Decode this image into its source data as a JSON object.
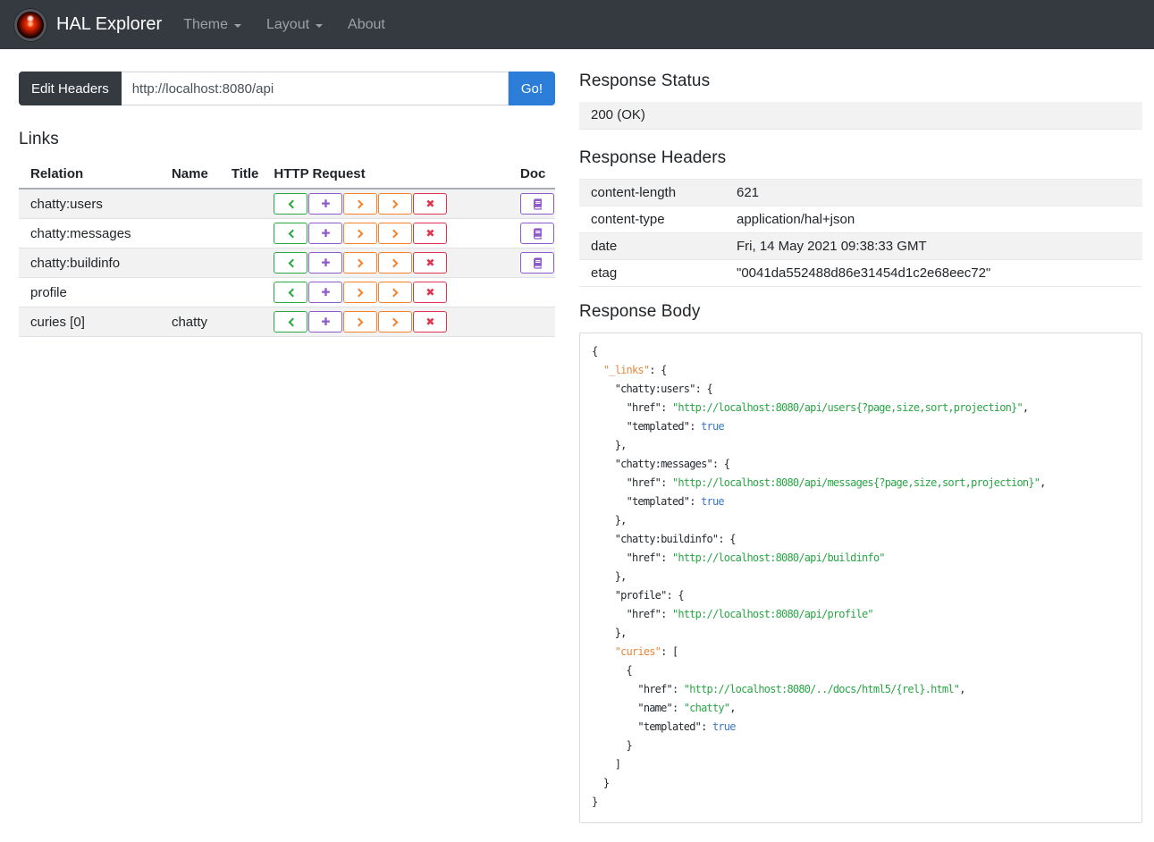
{
  "navbar": {
    "brand": "HAL Explorer",
    "logo": "hal-9000-eye-icon",
    "items": [
      {
        "label": "Theme",
        "has_dropdown": true
      },
      {
        "label": "Layout",
        "has_dropdown": true
      },
      {
        "label": "About",
        "has_dropdown": false
      }
    ]
  },
  "address_bar": {
    "edit_headers_label": "Edit Headers",
    "url_value": "http://localhost:8080/api",
    "go_label": "Go!"
  },
  "links": {
    "title": "Links",
    "columns": [
      "Relation",
      "Name",
      "Title",
      "HTTP Request",
      "Doc"
    ],
    "request_buttons": [
      {
        "method": "get",
        "icon": "chevron-left-icon",
        "glyph": ""
      },
      {
        "method": "post",
        "icon": "plus-icon",
        "glyph": "✚"
      },
      {
        "method": "put",
        "icon": "chevron-right-icon",
        "glyph": ""
      },
      {
        "method": "patch",
        "icon": "chevron-right-icon",
        "glyph": ""
      },
      {
        "method": "delete",
        "icon": "x-icon",
        "glyph": "✖"
      }
    ],
    "doc_icon": "book-icon",
    "rows": [
      {
        "relation": "chatty:users",
        "name": "",
        "title": "",
        "doc": true
      },
      {
        "relation": "chatty:messages",
        "name": "",
        "title": "",
        "doc": true
      },
      {
        "relation": "chatty:buildinfo",
        "name": "",
        "title": "",
        "doc": true
      },
      {
        "relation": "profile",
        "name": "",
        "title": "",
        "doc": false
      },
      {
        "relation": "curies [0]",
        "name": "chatty",
        "title": "",
        "doc": false
      }
    ]
  },
  "response_status": {
    "title": "Response Status",
    "value": "200 (OK)"
  },
  "response_headers": {
    "title": "Response Headers",
    "rows": [
      {
        "name": "content-length",
        "value": "621"
      },
      {
        "name": "content-type",
        "value": "application/hal+json"
      },
      {
        "name": "date",
        "value": "Fri, 14 May 2021 09:38:33 GMT"
      },
      {
        "name": "etag",
        "value": "\"0041da552488d86e31454d1c2e68eec72\""
      }
    ]
  },
  "response_body": {
    "title": "Response Body",
    "lines": [
      [
        {
          "c": "p",
          "t": "{"
        }
      ],
      [
        {
          "c": "p",
          "t": "  "
        },
        {
          "c": "h",
          "t": "\"_links\""
        },
        {
          "c": "p",
          "t": ": {"
        }
      ],
      [
        {
          "c": "p",
          "t": "    "
        },
        {
          "c": "k",
          "t": "\"chatty:users\""
        },
        {
          "c": "p",
          "t": ": {"
        }
      ],
      [
        {
          "c": "p",
          "t": "      "
        },
        {
          "c": "k",
          "t": "\"href\""
        },
        {
          "c": "p",
          "t": ": "
        },
        {
          "c": "s",
          "t": "\"http://localhost:8080/api/users{?page,size,sort,projection}\""
        },
        {
          "c": "p",
          "t": ","
        }
      ],
      [
        {
          "c": "p",
          "t": "      "
        },
        {
          "c": "k",
          "t": "\"templated\""
        },
        {
          "c": "p",
          "t": ": "
        },
        {
          "c": "b",
          "t": "true"
        }
      ],
      [
        {
          "c": "p",
          "t": "    },"
        }
      ],
      [
        {
          "c": "p",
          "t": "    "
        },
        {
          "c": "k",
          "t": "\"chatty:messages\""
        },
        {
          "c": "p",
          "t": ": {"
        }
      ],
      [
        {
          "c": "p",
          "t": "      "
        },
        {
          "c": "k",
          "t": "\"href\""
        },
        {
          "c": "p",
          "t": ": "
        },
        {
          "c": "s",
          "t": "\"http://localhost:8080/api/messages{?page,size,sort,projection}\""
        },
        {
          "c": "p",
          "t": ","
        }
      ],
      [
        {
          "c": "p",
          "t": "      "
        },
        {
          "c": "k",
          "t": "\"templated\""
        },
        {
          "c": "p",
          "t": ": "
        },
        {
          "c": "b",
          "t": "true"
        }
      ],
      [
        {
          "c": "p",
          "t": "    },"
        }
      ],
      [
        {
          "c": "p",
          "t": "    "
        },
        {
          "c": "k",
          "t": "\"chatty:buildinfo\""
        },
        {
          "c": "p",
          "t": ": {"
        }
      ],
      [
        {
          "c": "p",
          "t": "      "
        },
        {
          "c": "k",
          "t": "\"href\""
        },
        {
          "c": "p",
          "t": ": "
        },
        {
          "c": "s",
          "t": "\"http://localhost:8080/api/buildinfo\""
        }
      ],
      [
        {
          "c": "p",
          "t": "    },"
        }
      ],
      [
        {
          "c": "p",
          "t": "    "
        },
        {
          "c": "k",
          "t": "\"profile\""
        },
        {
          "c": "p",
          "t": ": {"
        }
      ],
      [
        {
          "c": "p",
          "t": "      "
        },
        {
          "c": "k",
          "t": "\"href\""
        },
        {
          "c": "p",
          "t": ": "
        },
        {
          "c": "s",
          "t": "\"http://localhost:8080/api/profile\""
        }
      ],
      [
        {
          "c": "p",
          "t": "    },"
        }
      ],
      [
        {
          "c": "p",
          "t": "    "
        },
        {
          "c": "h",
          "t": "\"curies\""
        },
        {
          "c": "p",
          "t": ": ["
        }
      ],
      [
        {
          "c": "p",
          "t": "      {"
        }
      ],
      [
        {
          "c": "p",
          "t": "        "
        },
        {
          "c": "k",
          "t": "\"href\""
        },
        {
          "c": "p",
          "t": ": "
        },
        {
          "c": "s",
          "t": "\"http://localhost:8080/../docs/html5/{rel}.html\""
        },
        {
          "c": "p",
          "t": ","
        }
      ],
      [
        {
          "c": "p",
          "t": "        "
        },
        {
          "c": "k",
          "t": "\"name\""
        },
        {
          "c": "p",
          "t": ": "
        },
        {
          "c": "s",
          "t": "\"chatty\""
        },
        {
          "c": "p",
          "t": ","
        }
      ],
      [
        {
          "c": "p",
          "t": "        "
        },
        {
          "c": "k",
          "t": "\"templated\""
        },
        {
          "c": "p",
          "t": ": "
        },
        {
          "c": "b",
          "t": "true"
        }
      ],
      [
        {
          "c": "p",
          "t": "      }"
        }
      ],
      [
        {
          "c": "p",
          "t": "    ]"
        }
      ],
      [
        {
          "c": "p",
          "t": "  }"
        }
      ],
      [
        {
          "c": "p",
          "t": "}"
        }
      ]
    ]
  },
  "colors": {
    "navbar_bg": "#343a40",
    "navbar_link": "#9ba1a6",
    "accent_blue": "#2b7dd8",
    "get_green": "#28a745",
    "post_purple": "#8e5bc8",
    "put_orange": "#f5822a",
    "delete_red": "#df3550",
    "stripe_gray": "#f2f2f2",
    "hal_eye_red": "#f33000",
    "json_key": "#24292e",
    "json_hal_key": "#e8863a",
    "json_string": "#2aa546",
    "json_literal": "#3b78c3",
    "json_punct": "#24292e"
  }
}
